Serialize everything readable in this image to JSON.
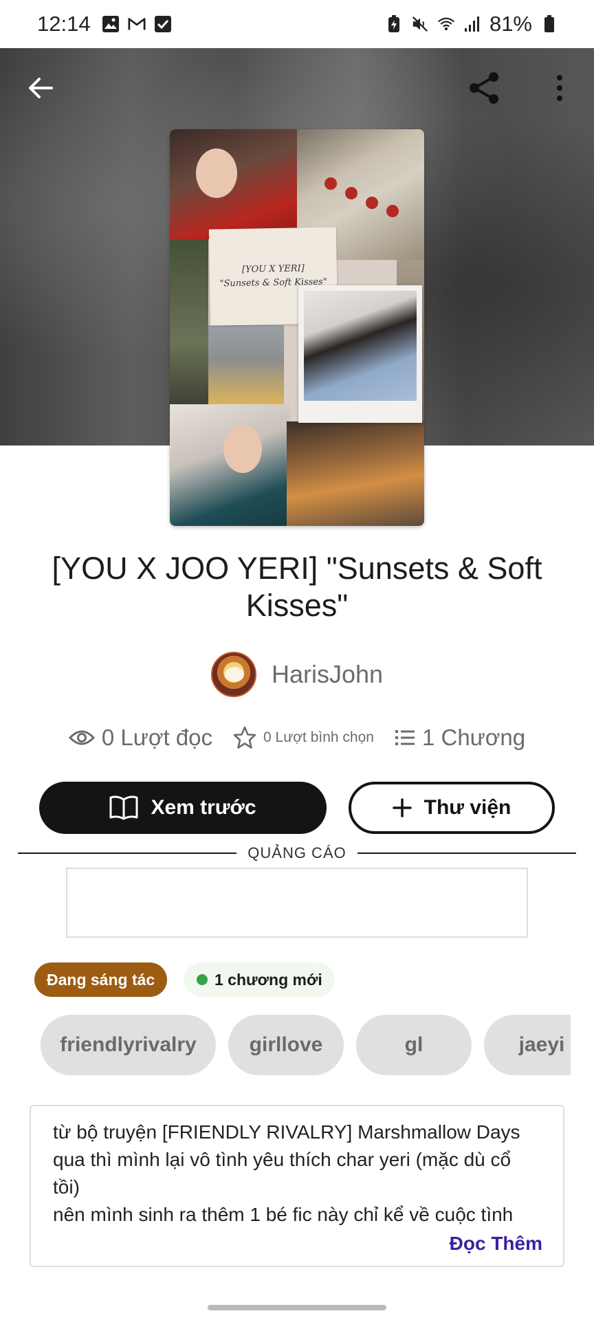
{
  "status_bar": {
    "time": "12:14",
    "battery": "81%",
    "icons": [
      "image-icon",
      "gmail-icon",
      "checkbox-icon",
      "battery-saver-icon",
      "mute-icon",
      "wifi-icon",
      "signal-icon",
      "battery-icon"
    ]
  },
  "toolbar": {
    "back_icon": "arrow-left-icon",
    "share_icon": "share-icon",
    "more_icon": "more-vertical-icon"
  },
  "cover": {
    "note_line1": "[YOU X YERI]",
    "note_line2": "\"Sunsets & Soft Kisses\""
  },
  "story": {
    "title": "[YOU X JOO YERI] \"Sunsets & Soft Kisses\"",
    "author": "HarisJohn"
  },
  "stats": {
    "reads": "0 Lượt đọc",
    "votes": "0 Lượt bình chọn",
    "chapters": "1 Chương"
  },
  "actions": {
    "preview_label": "Xem trước",
    "library_label": "Thư viện"
  },
  "ads": {
    "label": "QUẢNG CÁO"
  },
  "badges": {
    "status": "Đang sáng tác",
    "new_chapters": "1 chương mới",
    "status_color": "#9c5c12",
    "new_dot_color": "#36a34a"
  },
  "tags": [
    "friendlyrivalry",
    "girllove",
    "gl",
    "jaeyi"
  ],
  "description": {
    "text": "từ bộ truyện [FRIENDLY RIVALRY] Marshmallow Days qua thì mình lại vô tình yêu thích char yeri (mặc dù cổ tồi)\nnên mình sinh ra thêm 1 bé fic này chỉ kể về cuộc tình",
    "read_more": "Đọc Thêm",
    "read_more_color": "#3b1fa3"
  }
}
